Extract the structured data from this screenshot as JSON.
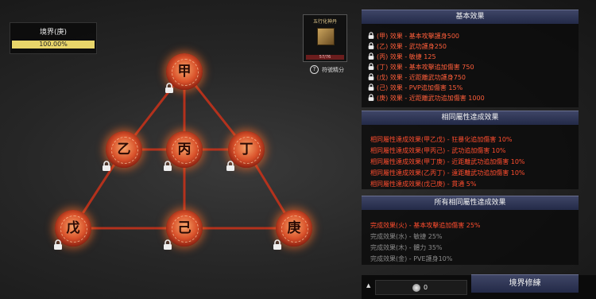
{
  "realm": {
    "title": "境界(庚)",
    "progress_text": "100.00%",
    "progress": 1.0
  },
  "item": {
    "name": "五行化神丹",
    "count": "57/76",
    "link_label": "符號精分"
  },
  "nodes": [
    {
      "key": "jia",
      "label": "甲"
    },
    {
      "key": "yi",
      "label": "乙"
    },
    {
      "key": "bing",
      "label": "丙"
    },
    {
      "key": "ding",
      "label": "丁"
    },
    {
      "key": "wu",
      "label": "戊"
    },
    {
      "key": "ji",
      "label": "己"
    },
    {
      "key": "geng",
      "label": "庚"
    }
  ],
  "basic": {
    "title": "基本效果",
    "rows": [
      "(甲) 效果 - 基本攻擊護身500",
      "(乙) 效果 - 武功護身250",
      "(丙) 效果 - 敏捷 125",
      "(丁) 效果 - 基本攻擊追加傷害 750",
      "(戊) 效果 - 近距離武功護身750",
      "(己) 效果 - PVP追加傷害 15%",
      "(庚) 效果 - 近距離武功追加傷害 1000"
    ]
  },
  "same": {
    "title": "相同屬性達成效果",
    "rows": [
      "相同屬性達成效果(甲乙戊) - 狂暴化追加傷害 10%",
      "相同屬性達成效果(甲丙己) - 武功追加傷害 10%",
      "相同屬性達成效果(甲丁庚) - 近距離武功追加傷害 10%",
      "相同屬性達成效果(乙丙丁) - 遠距離武功追加傷害 10%",
      "相同屬性達成效果(戊己庚) - 貫通 5%"
    ]
  },
  "all": {
    "title": "所有相同屬性達成效果",
    "rows": [
      "完成效果(火) - 基本攻擊追加傷害 25%",
      "完成效果(水) - 敏捷 25%",
      "完成效果(木) - 體力 35%",
      "完成效果(金) - PVE護身10%"
    ]
  },
  "currency": {
    "value": "0"
  },
  "button": {
    "label": "境界修練"
  },
  "colors": {
    "accent": "#ff5e3a",
    "header": "#2e3556",
    "line": "#c0301a",
    "progress": "#e8d56a"
  }
}
